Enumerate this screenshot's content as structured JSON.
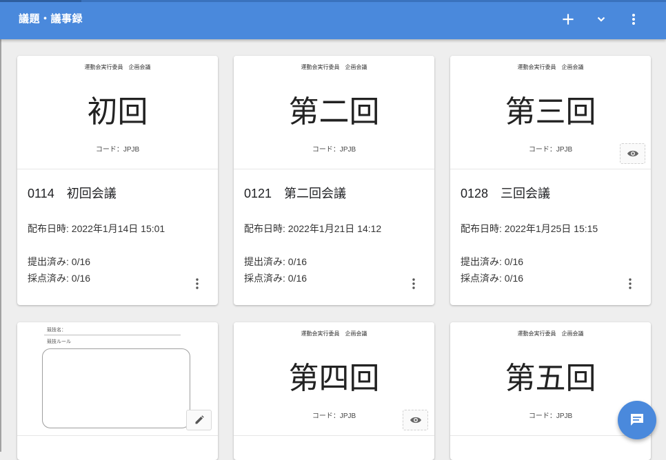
{
  "app": {
    "title": "議題・議事録"
  },
  "toolbar": {
    "add_icon": "plus-icon",
    "expand_icon": "chevron-down-icon",
    "menu_icon": "more-vert-icon"
  },
  "cards": [
    {
      "thumb_header": "運動会実行委員　企画会議",
      "thumb_big": "初回",
      "thumb_code": "コード：JPJB",
      "title": "0114　初回会議",
      "date": "配布日時: 2022年1月14日 15:01",
      "submitted": "提出済み: 0/16",
      "graded": "採点済み: 0/16"
    },
    {
      "thumb_header": "運動会実行委員　企画会議",
      "thumb_big": "第二回",
      "thumb_code": "コード：JPJB",
      "title": "0121　第二回会議",
      "date": "配布日時: 2022年1月21日 14:12",
      "submitted": "提出済み: 0/16",
      "graded": "採点済み: 0/16"
    },
    {
      "thumb_header": "運動会実行委員　企画会議",
      "thumb_big": "第三回",
      "thumb_code": "コード：JPJB",
      "title": "0128　三回会議",
      "date": "配布日時: 2022年1月25日 15:15",
      "submitted": "提出済み: 0/16",
      "graded": "採点済み: 0/16"
    },
    {
      "sheet_field1": "競技名：",
      "sheet_field2": "競技ルール"
    },
    {
      "thumb_header": "運動会実行委員　企画会議",
      "thumb_big": "第四回",
      "thumb_code": "コード：JPJB"
    },
    {
      "thumb_header": "運動会実行委員　企画会議",
      "thumb_big": "第五回",
      "thumb_code": "コード：JPJB"
    }
  ],
  "colors": {
    "appbar": "#4a89dc",
    "background": "#eeeeee",
    "fab": "#4a89dc"
  },
  "fab": {
    "icon": "chat-icon"
  }
}
